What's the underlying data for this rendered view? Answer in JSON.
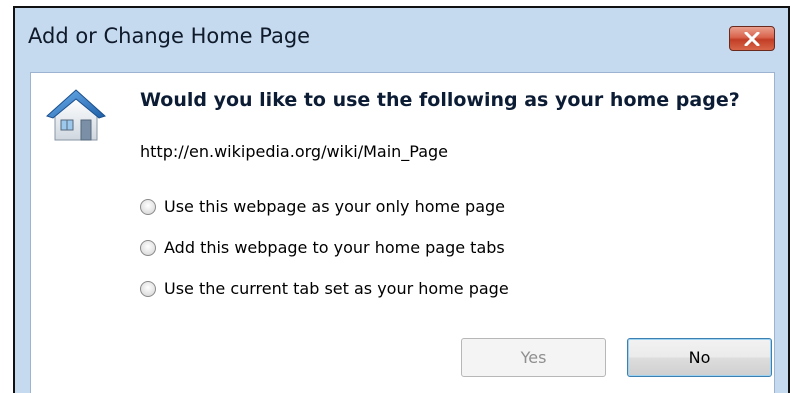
{
  "dialog": {
    "title": "Add or Change Home Page",
    "question": "Would you like to use the following as your home page?",
    "url": "http://en.wikipedia.org/wiki/Main_Page",
    "options": [
      {
        "label": "Use this webpage as your only home page",
        "selected": false
      },
      {
        "label": "Add this webpage to your home page tabs",
        "selected": false
      },
      {
        "label": "Use the current tab set as your home page",
        "selected": false
      }
    ],
    "buttons": {
      "yes": "Yes",
      "no": "No"
    },
    "icons": {
      "close": "close-icon",
      "house": "house-icon"
    }
  },
  "colors": {
    "frame": "#c5d9ef",
    "close_button": "#c9452c",
    "default_button_border": "#3c7fb1"
  }
}
